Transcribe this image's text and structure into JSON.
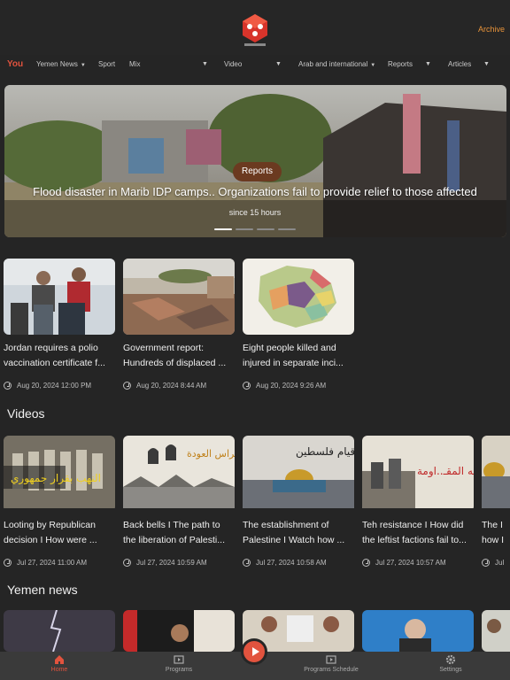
{
  "header": {
    "archive_label": "Archive",
    "accent_color": "#e2533e",
    "logo_icon": "red-cube-logo"
  },
  "tabs": [
    {
      "label": "You",
      "active": true
    },
    {
      "label": "Yemen News",
      "dropdown": true
    },
    {
      "label": "Sport"
    },
    {
      "label": "Mix",
      "dropdown": true
    },
    {
      "label": "Video",
      "dropdown": true
    },
    {
      "label": "Arab and international",
      "dropdown": true
    },
    {
      "label": "Reports",
      "dropdown": true
    },
    {
      "label": "Articles",
      "dropdown": true
    }
  ],
  "hero": {
    "badge": "Reports",
    "title": "Flood disaster in Marib IDP camps.. Organizations fail to provide relief to those affected",
    "time": "since 15 hours",
    "slide_count": 4,
    "active_slide": 1
  },
  "news": [
    {
      "title1": "Jordan requires a polio",
      "title2": "vaccination certificate f...",
      "date": "Aug 20, 2024 12:00 PM"
    },
    {
      "title1": "Government report:",
      "title2": "Hundreds of displaced ...",
      "date": "Aug 20, 2024 8:44 AM"
    },
    {
      "title1": "Eight people killed and",
      "title2": "injured in separate inci...",
      "date": "Aug 20, 2024 9:26 AM"
    }
  ],
  "videos_section": {
    "title": "Videos"
  },
  "videos": [
    {
      "title1": "Looting by Republican",
      "title2": "decision   I   How were ...",
      "date": "Jul 27, 2024 11:00 AM",
      "thumb_text": "النهب بقرار جمهوري"
    },
    {
      "title1": "Back bells I The path to",
      "title2": "the liberation of Palesti...",
      "date": "Jul 27, 2024 10:59 AM",
      "thumb_text": "أجراس العودة"
    },
    {
      "title1": "The establishment of",
      "title2": "Palestine I  Watch how ...",
      "date": "Jul 27, 2024 10:58 AM",
      "thumb_text": "قيام فلسطين"
    },
    {
      "title1": "Teh resistance I How did",
      "title2": "the leftist factions fail to...",
      "date": "Jul 27, 2024 10:57 AM",
      "thumb_text": "تيه المقـ..اومة"
    },
    {
      "title1": "The I",
      "title2": "how I",
      "date": "Jul"
    }
  ],
  "yemen_section": {
    "title": "Yemen news"
  },
  "bottom_nav": [
    {
      "label": "Home",
      "icon": "home-icon",
      "active": true
    },
    {
      "label": "Programs",
      "icon": "programs-icon"
    },
    {
      "label": "Programs Schedule",
      "icon": "schedule-icon"
    },
    {
      "label": "Settings",
      "icon": "gear-icon"
    }
  ]
}
